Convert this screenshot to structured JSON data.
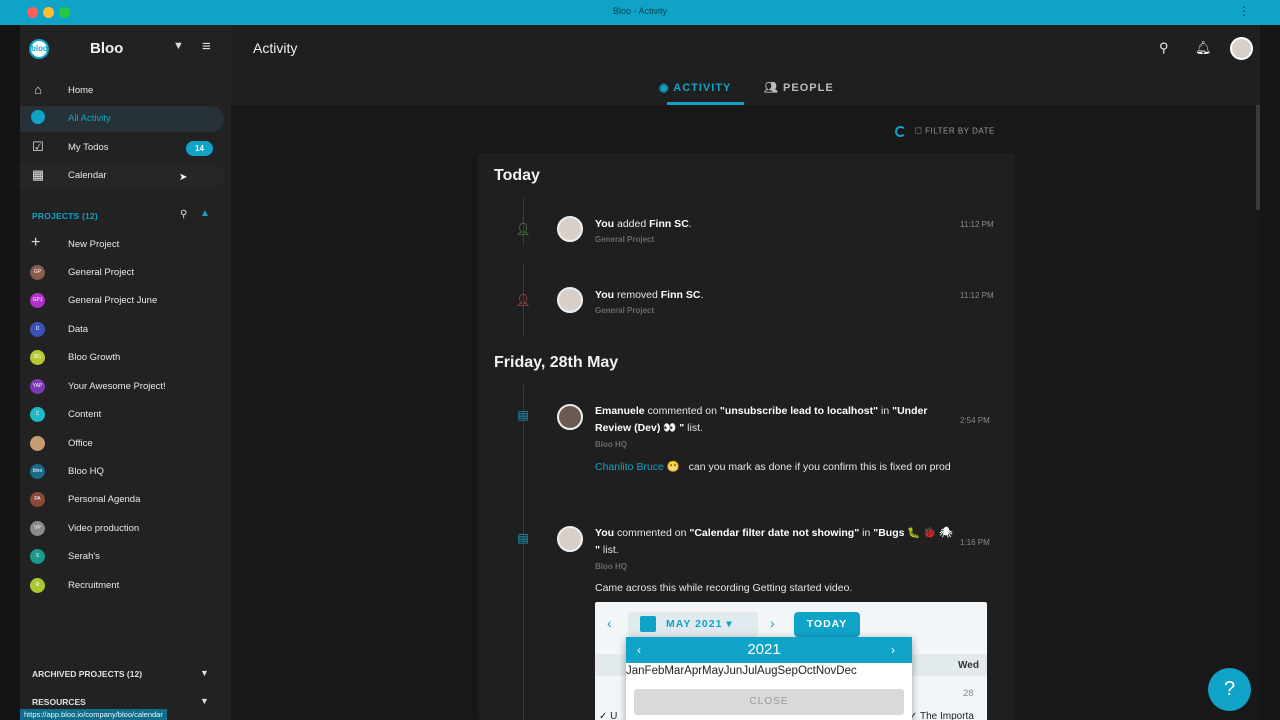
{
  "window": {
    "title": "Bloo - Activity"
  },
  "workspace": {
    "logo_text": "bloo",
    "name": "Bloo"
  },
  "nav": [
    {
      "label": "Home"
    },
    {
      "label": "All Activity"
    },
    {
      "label": "My Todos",
      "badge": "14"
    },
    {
      "label": "Calendar"
    }
  ],
  "projects": {
    "header": "PROJECTS (12)",
    "new_label": "New Project",
    "items": [
      {
        "label": "General Project",
        "abbr": "GP",
        "color": "#8a5a4a"
      },
      {
        "label": "General Project June",
        "abbr": "GPJ",
        "color": "#b032c8"
      },
      {
        "label": "Data",
        "abbr": "D",
        "color": "#3a52b8"
      },
      {
        "label": "Bloo Growth",
        "abbr": "BG",
        "color": "#b8c830"
      },
      {
        "label": "Your Awesome Project!",
        "abbr": "YAP",
        "color": "#7a3ab8"
      },
      {
        "label": "Content",
        "abbr": "C",
        "color": "#22b8c8"
      },
      {
        "label": "Office",
        "abbr": "",
        "color": "#c89a70"
      },
      {
        "label": "Bloo HQ",
        "abbr": "bloo",
        "color": "#1a6a8a"
      },
      {
        "label": "Personal Agenda",
        "abbr": "PA",
        "color": "#8a4a3a"
      },
      {
        "label": "Video production",
        "abbr": "VP",
        "color": "#8a8a8a"
      },
      {
        "label": "Serah's",
        "abbr": "S",
        "color": "#1a9a8a"
      },
      {
        "label": "Recruitment",
        "abbr": "R",
        "color": "#a8c830"
      }
    ]
  },
  "archived": {
    "header": "ARCHIVED PROJECTS (12)"
  },
  "resources": {
    "header": "RESOURCES"
  },
  "status_url": "https://app.bloo.io/company/bloo/calendar",
  "header": {
    "title": "Activity"
  },
  "tabs": [
    {
      "label": "ACTIVITY"
    },
    {
      "label": "PEOPLE"
    }
  ],
  "filter": {
    "label": "FILTER BY DATE"
  },
  "feed": {
    "today": "Today",
    "friday": "Friday, 28th May",
    "events": [
      {
        "actor": "You",
        "verb": "added",
        "object": "Finn SC",
        "tail": ".",
        "project": "General Project",
        "time": "11:12 PM"
      },
      {
        "actor": "You",
        "verb": "removed",
        "object": "Finn SC",
        "tail": ".",
        "project": "General Project",
        "time": "11:12 PM"
      },
      {
        "actor": "Emanuele",
        "verb": "commented on",
        "object": "\"unsubscribe lead to localhost\"",
        "mid": "in",
        "list": "\"Under Review (Dev) 👀 \"",
        "tail": "list.",
        "project": "Bloo HQ",
        "time": "2:54 PM",
        "mention_name": "Chanlito Bruce",
        "mention_emoji": "😬",
        "comment": "can you mark as done if you confirm this is fixed on prod"
      },
      {
        "actor": "You",
        "verb": "commented on",
        "object": "\"Calendar filter date not showing\"",
        "mid": "in",
        "list": "\"Bugs 🐛 🐞 🕷 \"",
        "tail": "list.",
        "project": "Bloo HQ",
        "time": "1:16 PM",
        "comment": "Came across this while recording Getting started video."
      }
    ]
  },
  "screenshot": {
    "month_label": "MAY 2021",
    "today_label": "TODAY",
    "weekday": "Wed",
    "day_num": "28",
    "year": "2021",
    "months": "JanFebMarAprMayJunJulAugSepOctNovDec",
    "close_label": "CLOSE",
    "event_left": "✓ U",
    "event_right": "✓ The Importa"
  },
  "help_label": "?"
}
